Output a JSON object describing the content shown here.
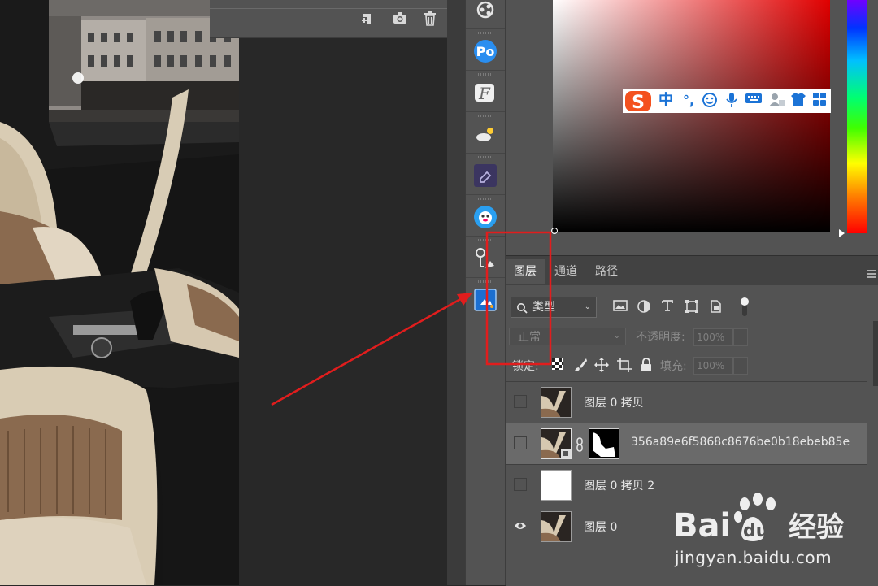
{
  "layers_panel": {
    "tabs": [
      {
        "label": "图层",
        "active": true
      },
      {
        "label": "通道",
        "active": false
      },
      {
        "label": "路径",
        "active": false
      }
    ],
    "filter_kind": "类型",
    "blend_mode": "正常",
    "opacity_label": "不透明度:",
    "opacity_value": "100%",
    "lock_label": "锁定:",
    "fill_label": "填充:",
    "fill_value": "100%",
    "layers": [
      {
        "name": "图层 0 拷贝",
        "visible": false,
        "selected": false
      },
      {
        "name": "356a89e6f5868c8676be0b18ebeb85e",
        "visible": false,
        "selected": true,
        "has_mask": true
      },
      {
        "name": "图层 0 拷贝 2",
        "visible": false,
        "selected": false
      },
      {
        "name": "图层 0",
        "visible": true,
        "selected": false
      }
    ]
  },
  "ime_bar": {
    "items": [
      "中",
      "°,"
    ]
  },
  "plugins": [
    "share-plugin-icon",
    "ps-plugin-icon",
    "font-plugin-icon",
    "weather-plugin-icon",
    "eraser-plugin-icon",
    "mascot-plugin-icon",
    "brush-tool-plugin-icon",
    "extension-plugin-icon"
  ],
  "watermark": {
    "logo_text": "Bai du 经验",
    "url": "jingyan.baidu.com"
  },
  "colors": {
    "panel_bg": "#535353",
    "annotation_red": "#e11d1d",
    "ime_blue": "#1b73d6",
    "sogou_orange": "#f4511e"
  }
}
